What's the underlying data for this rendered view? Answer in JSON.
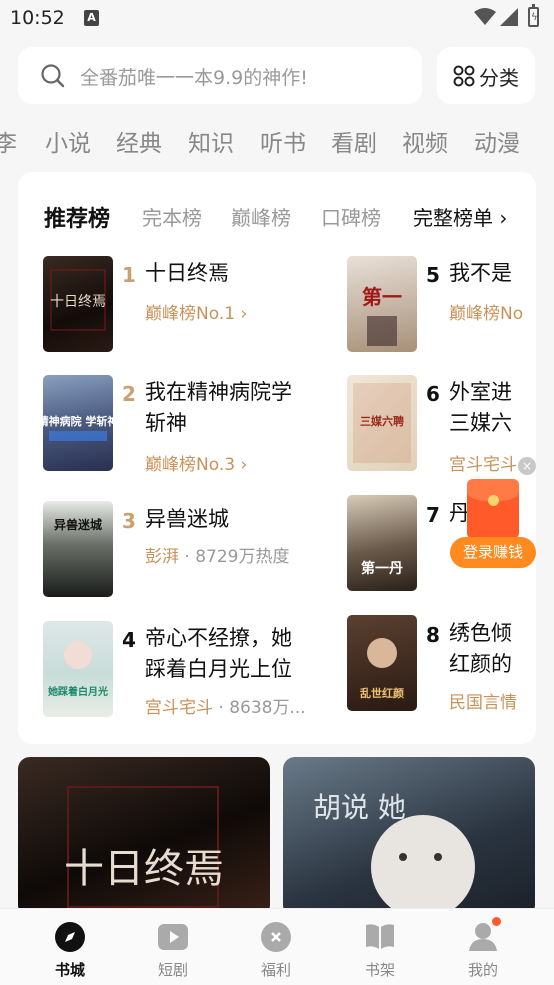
{
  "status_bar": {
    "time": "10:52",
    "notif_letter": "A",
    "battery_glyph": "ϟ"
  },
  "search": {
    "placeholder": "全番茄唯一一本9.9的神作!"
  },
  "category_button": {
    "label": "分类"
  },
  "channel_tabs": [
    "李",
    "小说",
    "经典",
    "知识",
    "听书",
    "看剧",
    "视频",
    "动漫"
  ],
  "ranking": {
    "tabs": [
      "推荐榜",
      "完本榜",
      "巅峰榜",
      "口碑榜"
    ],
    "full_list_label": "完整榜单 ›",
    "books": [
      {
        "rank": "1",
        "title": [
          "十日终焉"
        ],
        "sub": "巅峰榜No.1 ›",
        "meta": ""
      },
      {
        "rank": "2",
        "title": [
          "我在精神病院学",
          "斩神"
        ],
        "sub": "巅峰榜No.3 ›",
        "meta": ""
      },
      {
        "rank": "3",
        "title": [
          "异兽迷城"
        ],
        "sub": "彭湃",
        "meta": " · 8729万热度"
      },
      {
        "rank": "4",
        "title": [
          "帝心不经撩，她",
          "踩着白月光上位"
        ],
        "sub": "宫斗宅斗",
        "meta": " · 8638万..."
      },
      {
        "rank": "5",
        "title": [
          "我不是"
        ],
        "sub": "巅峰榜No",
        "meta": ""
      },
      {
        "rank": "6",
        "title": [
          "外室进",
          "三媒六"
        ],
        "sub": "宫斗宅斗",
        "meta": ""
      },
      {
        "rank": "7",
        "title": [
          "丹"
        ],
        "sub": "",
        "meta": ""
      },
      {
        "rank": "8",
        "title": [
          "绣色倾",
          "红颜的"
        ],
        "sub": "民国言情",
        "meta": ""
      }
    ],
    "cover_text": [
      "十日终焉",
      "精神病院 学斩神",
      "异兽迷城",
      "她踩着白月光",
      "第一",
      "三媒六聘",
      "第一丹",
      "乱世红颜"
    ]
  },
  "floating_reward": {
    "label": "登录赚钱",
    "close": "×"
  },
  "banners": [
    {
      "text": "十日终焉"
    },
    {
      "text": "胡说 她"
    }
  ],
  "bottom_nav": [
    {
      "label": "书城",
      "icon": "compass-icon",
      "active": true
    },
    {
      "label": "短剧",
      "icon": "play-icon",
      "active": false
    },
    {
      "label": "福利",
      "icon": "coin-icon",
      "active": false
    },
    {
      "label": "书架",
      "icon": "book-icon",
      "active": false
    },
    {
      "label": "我的",
      "icon": "profile-icon",
      "active": false
    }
  ],
  "colors": {
    "gold": "#c9925a",
    "rank_gold": "#c9a070",
    "accent": "#ff8a1f"
  }
}
